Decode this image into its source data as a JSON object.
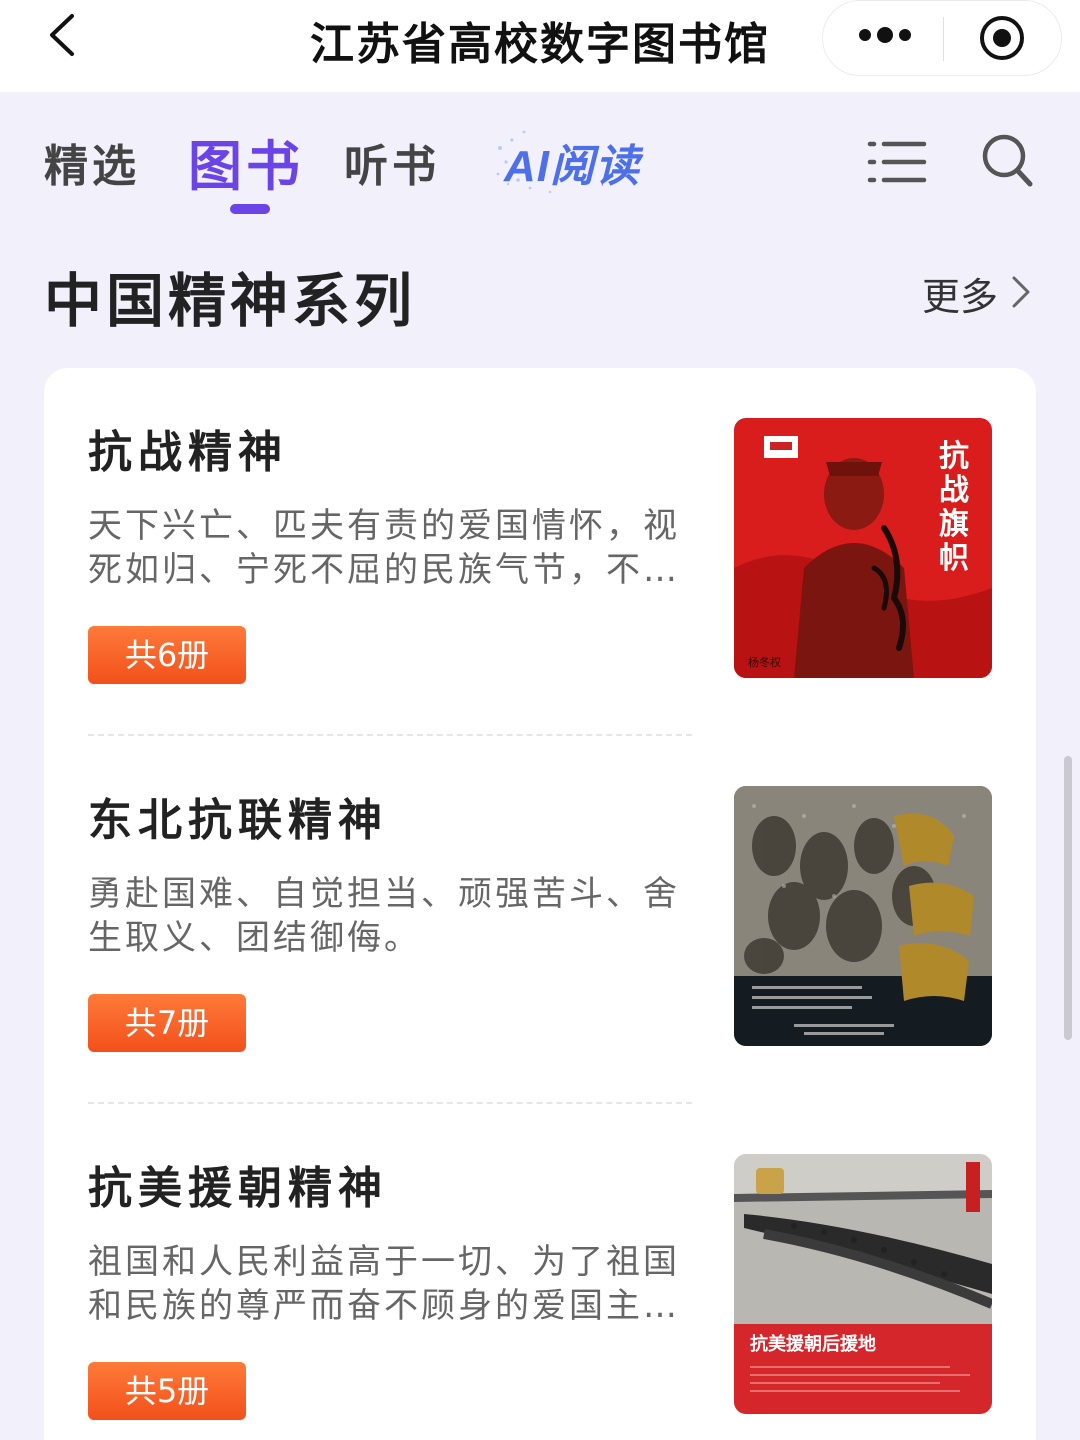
{
  "titlebar": {
    "title": "江苏省高校数字图书馆",
    "back_icon": "chevron-left-icon",
    "more_icon": "more-dots-icon",
    "close_icon": "mini-program-close-icon"
  },
  "tabs": [
    {
      "label": "精选",
      "active": false
    },
    {
      "label": "图书",
      "active": true
    },
    {
      "label": "听书",
      "active": false
    }
  ],
  "ai_read": {
    "label": "AI阅读"
  },
  "toolbar_icons": [
    "list-icon",
    "search-icon"
  ],
  "section": {
    "title": "中国精神系列",
    "more_label": "更多"
  },
  "items": [
    {
      "title": "抗战精神",
      "desc": "天下兴亡、匹夫有责的爱国情怀，视死如归、宁死不屈的民族气节，不…",
      "count": "共6册",
      "cover": {
        "title_vertical": "抗战旗帜",
        "author": "杨冬权"
      }
    },
    {
      "title": "东北抗联精神",
      "desc": "勇赴国难、自觉担当、顽强苦斗、舍生取义、团结御侮。",
      "count": "共7册",
      "cover": {
        "title_vertical": "独立营"
      }
    },
    {
      "title": "抗美援朝精神",
      "desc": "祖国和人民利益高于一切、为了祖国和民族的尊严而奋不顾身的爱国主…",
      "count": "共5册",
      "cover": {
        "title": "抗美援朝后援地"
      }
    }
  ],
  "colors": {
    "accent": "#6a44e6",
    "badge": "#f2501a",
    "background": "#f2f1fb"
  }
}
